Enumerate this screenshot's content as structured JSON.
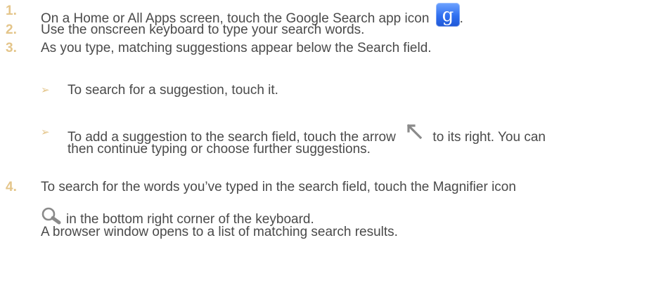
{
  "steps": [
    {
      "number": "1.",
      "text_before_icon": "On a Home or All Apps screen, touch the Google Search app icon",
      "text_after_icon": "."
    },
    {
      "number": "2.",
      "text": "Use the onscreen keyboard to type your search words."
    },
    {
      "number": "3.",
      "text": "As you type, matching suggestions appear below the Search field."
    },
    {
      "number": "4.",
      "line1": "To search for the words you’ve typed in the search field, touch the Magnifier icon",
      "line2": "in the bottom right corner of the keyboard.",
      "line3": "A browser window opens to a list of matching search results."
    }
  ],
  "bullets": [
    {
      "marker": "➢",
      "text": "To search for a suggestion, touch it."
    },
    {
      "marker": "➢",
      "line1_before_icon": "To add a suggestion to the search field, touch the arrow",
      "line1_after_icon": "to its right. You can",
      "line2": "then continue typing or choose further suggestions."
    }
  ],
  "icons": {
    "google_search": "google-search-app-icon",
    "arrow": "up-left-arrow-icon",
    "magnifier": "magnifier-icon"
  },
  "colors": {
    "number": "#e4c58a",
    "text": "#4a4a4a",
    "google_icon": "#2f6ff0"
  }
}
